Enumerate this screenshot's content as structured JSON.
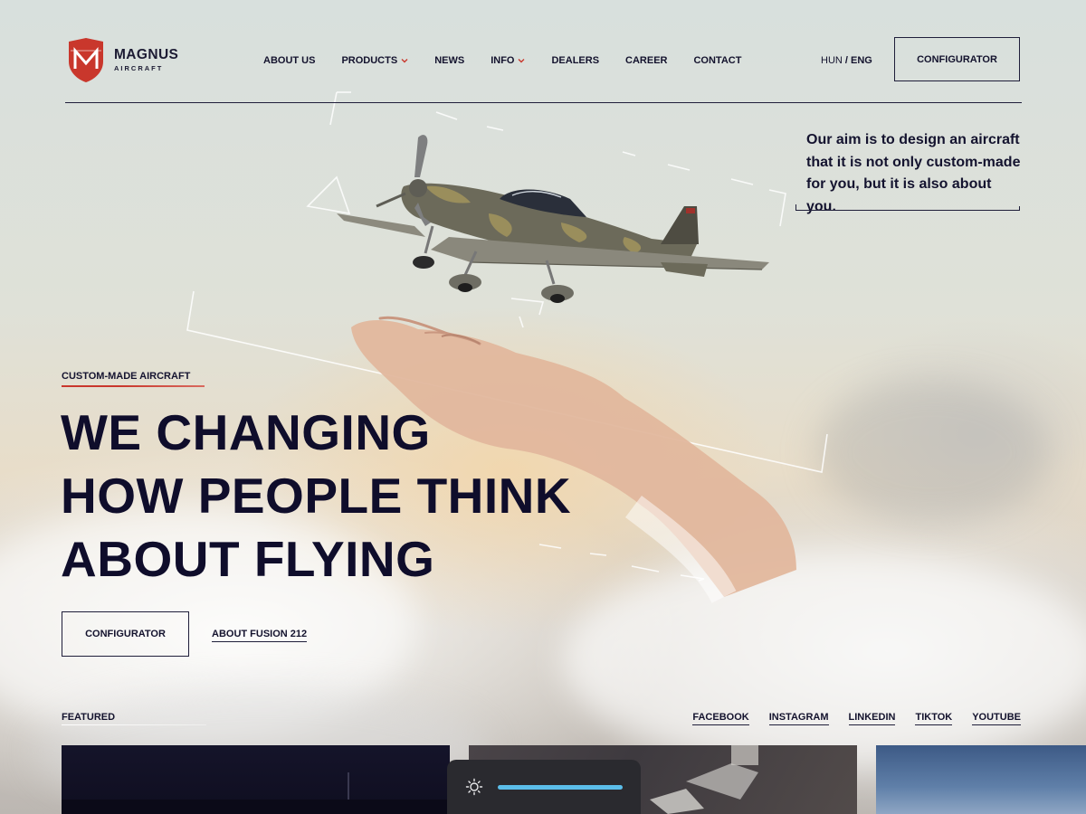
{
  "brand": {
    "name": "MAGNUS",
    "sub": "AIRCRAFT",
    "color": "#c9372c"
  },
  "nav": {
    "items": [
      {
        "label": "ABOUT US"
      },
      {
        "label": "PRODUCTS",
        "dropdown": true
      },
      {
        "label": "NEWS"
      },
      {
        "label": "INFO",
        "dropdown": true
      },
      {
        "label": "DEALERS"
      },
      {
        "label": "CAREER"
      },
      {
        "label": "CONTACT"
      }
    ],
    "lang_inactive": "HUN",
    "lang_separator": " / ",
    "lang_active": "ENG",
    "configurator": "CONFIGURATOR"
  },
  "tagline": "Our aim is to design an aircraft that it is not only custom-made for you, but it is also about you.",
  "hero": {
    "eyebrow": "CUSTOM-MADE AIRCRAFT",
    "headline": [
      "WE CHANGING",
      "HOW PEOPLE THINK",
      "ABOUT FLYING"
    ],
    "configurator": "CONFIGURATOR",
    "about_link": "ABOUT FUSION 212"
  },
  "featured": {
    "label": "FEATURED"
  },
  "social": [
    "FACEBOOK",
    "INSTAGRAM",
    "LINKEDIN",
    "TIKTOK",
    "YOUTUBE"
  ],
  "brightness": {
    "icon": "sun-icon",
    "accent": "#5bbde9"
  }
}
